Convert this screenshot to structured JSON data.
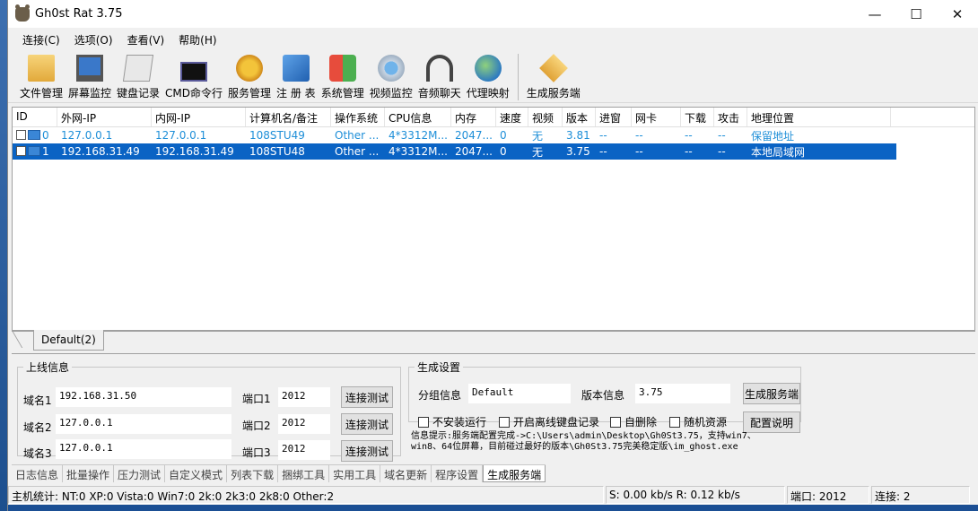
{
  "window": {
    "title": "Gh0st Rat 3.75"
  },
  "menu": [
    "连接(C)",
    "选项(O)",
    "查看(V)",
    "帮助(H)"
  ],
  "toolbar": [
    {
      "label": "文件管理",
      "icon": "folder-icon"
    },
    {
      "label": "屏幕监控",
      "icon": "monitor-icon"
    },
    {
      "label": "键盘记录",
      "icon": "keyboard-icon"
    },
    {
      "label": "CMD命令行",
      "icon": "terminal-icon"
    },
    {
      "label": "服务管理",
      "icon": "gears-icon"
    },
    {
      "label": "注 册 表",
      "icon": "registry-icon"
    },
    {
      "label": "系统管理",
      "icon": "windows-icon"
    },
    {
      "label": "视频监控",
      "icon": "webcam-icon"
    },
    {
      "label": "音频聊天",
      "icon": "headset-icon"
    },
    {
      "label": "代理映射",
      "icon": "globe-icon"
    },
    {
      "label": "生成服务端",
      "icon": "package-icon"
    }
  ],
  "table": {
    "columns": [
      "ID",
      "外网-IP",
      "内网-IP",
      "计算机名/备注",
      "操作系统",
      "CPU信息",
      "内存",
      "速度",
      "视频",
      "版本",
      "进窗",
      "网卡",
      "下载",
      "攻击",
      "地理位置"
    ],
    "rows": [
      [
        "0",
        "127.0.0.1",
        "127.0.0.1",
        "108STU49",
        "Other ...",
        "4*3312M...",
        "2047...",
        "0",
        "无",
        "3.81",
        "--",
        "--",
        "--",
        "--",
        "保留地址"
      ],
      [
        "1",
        "192.168.31.49",
        "192.168.31.49",
        "108STU48",
        "Other ...",
        "4*3312M...",
        "2047...",
        "0",
        "无",
        "3.75",
        "--",
        "--",
        "--",
        "--",
        "本地局域网"
      ]
    ]
  },
  "group_tab": "Default(2)",
  "online": {
    "legend": "上线信息",
    "domain1_label": "域名1",
    "domain1": "192.168.31.50",
    "port1_label": "端口1",
    "port1": "2012",
    "domain2_label": "域名2",
    "domain2": "127.0.0.1",
    "port2_label": "端口2",
    "port2": "2012",
    "domain3_label": "域名3",
    "domain3": "127.0.0.1",
    "port3_label": "端口3",
    "port3": "2012",
    "test_label": "连接测试"
  },
  "build": {
    "legend": "生成设置",
    "group_label": "分组信息",
    "group_value": "Default",
    "version_label": "版本信息",
    "version_value": "3.75",
    "build_button": "生成服务端",
    "opt_noinstall": "不安装运行",
    "opt_offline_keylog": "开启离线键盘记录",
    "opt_selfdelete": "自删除",
    "opt_random": "随机资源",
    "config_button": "配置说明"
  },
  "info_text_line1": "信息提示:服务端配置完成->C:\\Users\\admin\\Desktop\\Gh0St3.75，支持win7、",
  "info_text_line2": "win8、64位屏幕，目前碰过最好的版本\\Gh0St3.75完美稳定版\\im_ghost.exe",
  "bottom_tabs": [
    "日志信息",
    "批量操作",
    "压力测试",
    "自定义模式",
    "列表下载",
    "捆绑工具",
    "实用工具",
    "域名更新",
    "程序设置",
    "生成服务端"
  ],
  "status": {
    "stats": "主机统计:  NT:0  XP:0  Vista:0  Win7:0  2k:0  2k3:0  2k8:0  Other:2",
    "speed": "S: 0.00 kb/s R: 0.12 kb/s",
    "port": "端口: 2012",
    "connections": "连接: 2"
  }
}
